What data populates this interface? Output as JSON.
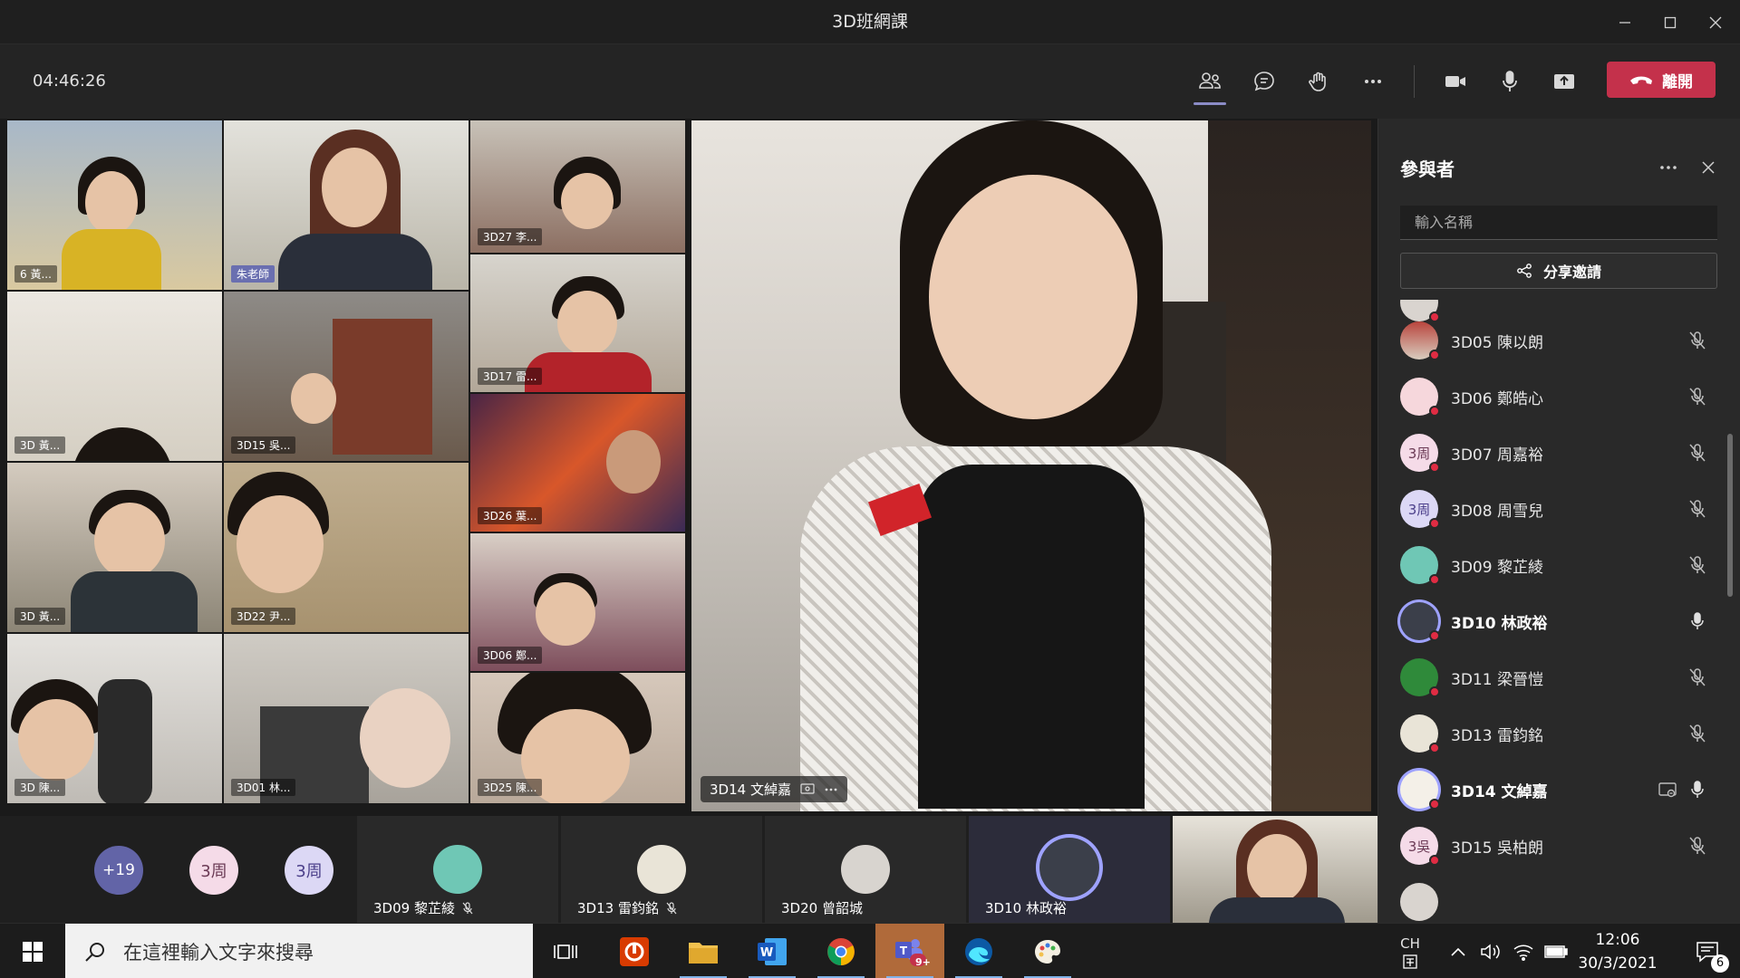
{
  "window": {
    "title": "3D班網課"
  },
  "meeting": {
    "timer": "04:46:26",
    "leave_label": "離開"
  },
  "stage": {
    "grid_tags": [
      "6 黃...",
      "朱老師",
      "3D27 李...",
      "3D17 雷...",
      "3D 黃...",
      "3D15 吳...",
      "3D26 葉...",
      "3D 黃...",
      "3D22 尹...",
      "3D06 鄭...",
      "3D 陳...",
      "3D01 林...",
      "3D25 陳..."
    ],
    "spotlight_name": "3D14 文綽嘉"
  },
  "strip": {
    "overflow": "+19",
    "initials_a": "3周",
    "initials_b": "3周",
    "tiles": [
      {
        "name": "3D09 黎芷綾"
      },
      {
        "name": "3D13 雷鈞銘"
      },
      {
        "name": "3D20 曾韶城"
      },
      {
        "name": "3D10 林政裕"
      }
    ]
  },
  "panel": {
    "title": "參與者",
    "search_placeholder": "輸入名稱",
    "share_label": "分享邀請",
    "participants": [
      {
        "name": "3D05 陳以朗",
        "initials": "",
        "mic": "muted",
        "bold": false
      },
      {
        "name": "3D06 鄭皓心",
        "initials": "",
        "mic": "muted",
        "bold": false
      },
      {
        "name": "3D07 周嘉裕",
        "initials": "3周",
        "mic": "muted",
        "bold": false
      },
      {
        "name": "3D08 周雪兒",
        "initials": "3周",
        "mic": "muted",
        "bold": false
      },
      {
        "name": "3D09 黎芷綾",
        "initials": "",
        "mic": "muted",
        "bold": false
      },
      {
        "name": "3D10 林政裕",
        "initials": "",
        "mic": "on",
        "bold": true
      },
      {
        "name": "3D11 梁晉愷",
        "initials": "",
        "mic": "muted",
        "bold": false
      },
      {
        "name": "3D13 雷鈞銘",
        "initials": "",
        "mic": "muted",
        "bold": false
      },
      {
        "name": "3D14 文綽嘉",
        "initials": "",
        "mic": "on",
        "bold": true
      },
      {
        "name": "3D15 吳柏朗",
        "initials": "3吳",
        "mic": "muted",
        "bold": false
      }
    ]
  },
  "taskbar": {
    "search_placeholder": "在這裡輸入文字來搜尋",
    "lang": "CH",
    "time": "12:06",
    "date": "30/3/2021",
    "teams_badge": "9+",
    "notif_count": "6"
  },
  "colors": {
    "leave": "#c4314b",
    "accent": "#8b8cc7",
    "presence_busy": "#e02c43"
  }
}
